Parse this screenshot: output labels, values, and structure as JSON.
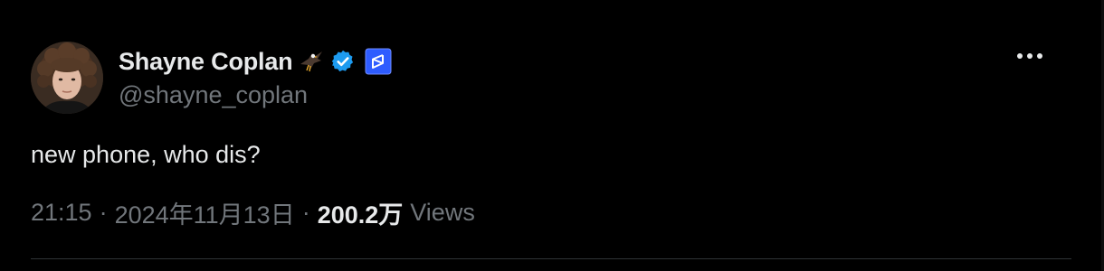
{
  "author": {
    "display_name": "Shayne Coplan",
    "handle": "@shayne_coplan",
    "emoji_icon": "eagle-emoji-icon",
    "verified_icon": "verified-badge-icon",
    "affiliate_icon": "polymarket-affiliate-icon"
  },
  "tweet": {
    "text": "new phone, who dis?"
  },
  "meta": {
    "time": "21:15",
    "separator": "·",
    "date": "2024年11月13日",
    "views_count": "200.2万",
    "views_label": "Views"
  },
  "actions": {
    "more_icon": "more-options-icon"
  },
  "colors": {
    "background": "#000000",
    "primary_text": "#e7e9ea",
    "secondary_text": "#71767b",
    "verified_blue": "#1d9bf0",
    "affiliate_blue": "#2e5cff",
    "divider": "#2f3336"
  }
}
